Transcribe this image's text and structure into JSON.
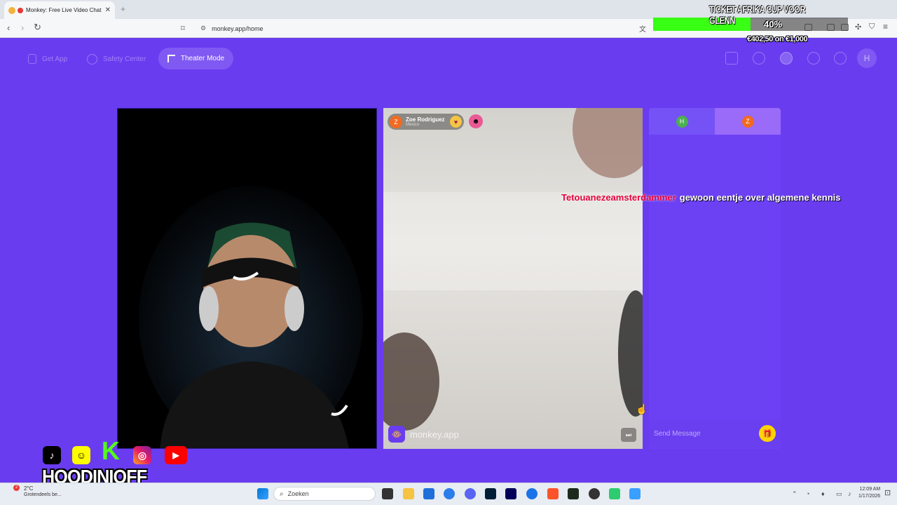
{
  "browser": {
    "tab_title": "Monkey: Free Live Video Chat",
    "new_tab": "+",
    "url": "monkey.app/home"
  },
  "overlay": {
    "goal_title": "TICKET AFRIKA CUP VOOR GLENN",
    "goal_percent": "40%",
    "goal_progress": 0.5,
    "goal_amount": "€402,50 on €1,000"
  },
  "nav": {
    "get_app": "Get App",
    "safety_center": "Safety Center",
    "theater_mode": "Theater Mode",
    "user_initial": "H"
  },
  "remote_user": {
    "initial": "Z",
    "name": "Zoe Rodriguez",
    "country": "Mexico"
  },
  "chat": {
    "tab_self_initial": "H",
    "tab_remote_initial": "Z",
    "placeholder": "Send Message"
  },
  "watermark": "monkey.app",
  "stream_chat": {
    "username": "Tetouanezeamsterdammer",
    "message": "gewoon eentje over algemene kennis"
  },
  "branding": {
    "name": "HOODINIOFF"
  },
  "taskbar": {
    "weather_temp": "2°C",
    "weather_desc": "Grotendeels be...",
    "weather_badge": "2",
    "search_label": "Zoeken",
    "time": "12:09 AM",
    "date": "1/17/2026"
  },
  "colors": {
    "app_bg": "#6a3cf0",
    "goal_fill": "#39ff14",
    "chat_username": "#e6003a",
    "gift": "#ffd400"
  }
}
